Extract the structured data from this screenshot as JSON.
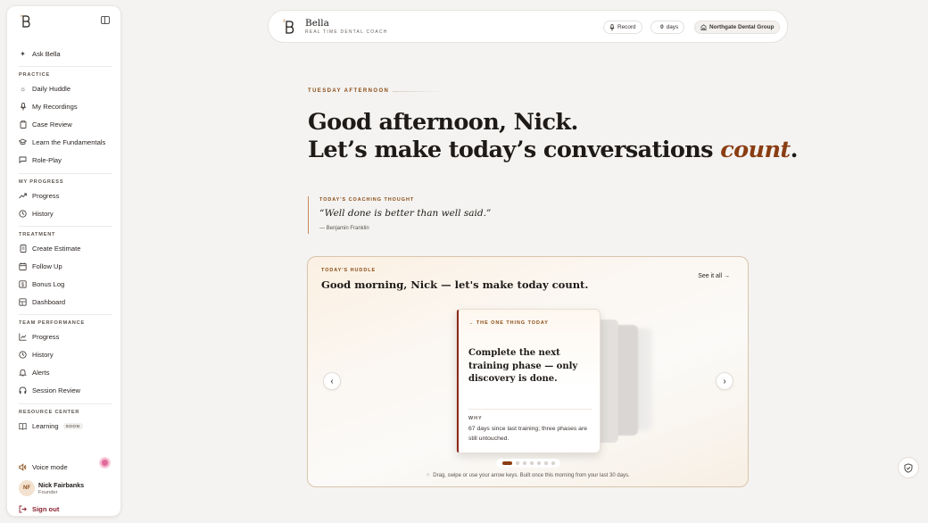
{
  "sidebar": {
    "ask": "Ask Bella",
    "sections": {
      "practice": "PRACTICE",
      "progress": "MY PROGRESS",
      "treatment": "TREATMENT",
      "team": "TEAM PERFORMANCE",
      "resource": "RESOURCE CENTER"
    },
    "items": {
      "daily_huddle": "Daily Huddle",
      "my_recordings": "My Recordings",
      "case_review": "Case Review",
      "fundamentals": "Learn the Fundamentals",
      "role_play": "Role-Play",
      "progress": "Progress",
      "history": "History",
      "create_estimate": "Create Estimate",
      "follow_up": "Follow Up",
      "bonus_log": "Bonus Log",
      "dashboard": "Dashboard",
      "team_progress": "Progress",
      "team_history": "History",
      "alerts": "Alerts",
      "session_review": "Session Review",
      "learning": "Learning",
      "soon": "SOON"
    },
    "voice_mode": "Voice mode",
    "user": {
      "initials": "NF",
      "name": "Nick Fairbanks",
      "role": "Founder"
    },
    "sign_out": "Sign out"
  },
  "topbar": {
    "logo_letter": "B",
    "title": "Bella",
    "subtitle": "REAL TIME DENTAL COACH",
    "record": "Record",
    "streak_count": "0",
    "streak_unit": "days",
    "org": "Northgate Dental Group"
  },
  "main": {
    "eyebrow": "TUESDAY AFTERNOON",
    "headline_line1": "Good afternoon, Nick.",
    "headline_line2": "Let’s make today’s conversations ",
    "headline_accent": "count",
    "headline_end": ".",
    "quote_label": "TODAY'S COACHING THOUGHT",
    "quote": "“Well done is better than well said.”",
    "quote_author": "— Benjamin Franklin"
  },
  "huddle": {
    "label": "TODAY'S HUDDLE",
    "title": "Good morning, Nick — let's make today count.",
    "see_all": "See it all →",
    "card": {
      "eyebrow": "→ THE ONE THING TODAY",
      "body": "Complete the next training phase — only discovery is done.",
      "why_label": "WHY",
      "why": "67 days since last training; three phases are still untouched."
    },
    "hint": "Drag, swipe or use your arrow keys. Built once this morning from your last 30 days.",
    "slide_count": 7,
    "active_slide": 1
  },
  "colors": {
    "accent": "#8a3d12",
    "brand": "#8a4b16",
    "danger": "#8b2330"
  }
}
